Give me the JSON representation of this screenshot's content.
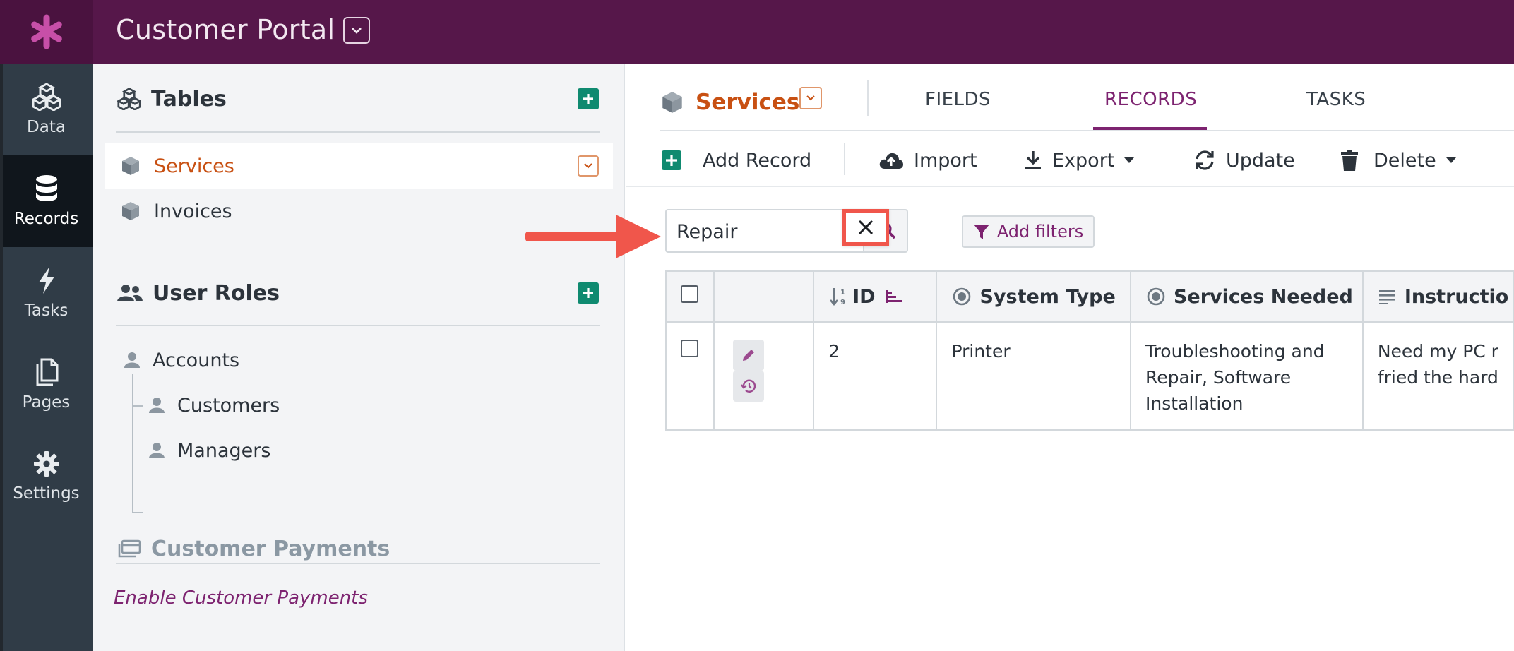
{
  "app": {
    "title": "Customer Portal"
  },
  "nav": [
    {
      "label": "Data",
      "icon": "cubes-icon"
    },
    {
      "label": "Records",
      "icon": "database-icon",
      "active": true
    },
    {
      "label": "Tasks",
      "icon": "bolt-icon"
    },
    {
      "label": "Pages",
      "icon": "pages-icon"
    },
    {
      "label": "Settings",
      "icon": "gear-icon"
    }
  ],
  "tables_section": {
    "title": "Tables",
    "items": [
      {
        "label": "Services",
        "active": true
      },
      {
        "label": "Invoices"
      }
    ]
  },
  "roles_section": {
    "title": "User Roles",
    "items": [
      {
        "label": "Accounts"
      },
      {
        "label": "Customers"
      },
      {
        "label": "Managers"
      }
    ]
  },
  "payments_section": {
    "title": "Customer Payments",
    "link": "Enable Customer Payments"
  },
  "content": {
    "object_title": "Services",
    "tabs": [
      {
        "label": "FIELDS"
      },
      {
        "label": "RECORDS",
        "active": true
      },
      {
        "label": "TASKS"
      }
    ]
  },
  "toolbar": {
    "add_record": "Add Record",
    "import": "Import",
    "export": "Export",
    "update": "Update",
    "delete": "Delete"
  },
  "search": {
    "value": "Repair"
  },
  "filters": {
    "label": "Add filters"
  },
  "table": {
    "columns": [
      "ID",
      "System Type",
      "Services Needed",
      "Instructio"
    ],
    "rows": [
      {
        "id": "2",
        "system_type": "Printer",
        "services_needed": "Troubleshooting and Repair, Software Installation",
        "instructions_line1": "Need my PC r",
        "instructions_line2": "fried the hard"
      }
    ]
  },
  "colors": {
    "brand_purple": "#56174a",
    "accent_orange": "#c85012",
    "link_purple": "#7d2370",
    "add_green": "#0f8a70",
    "highlight_red": "#f0564b"
  }
}
